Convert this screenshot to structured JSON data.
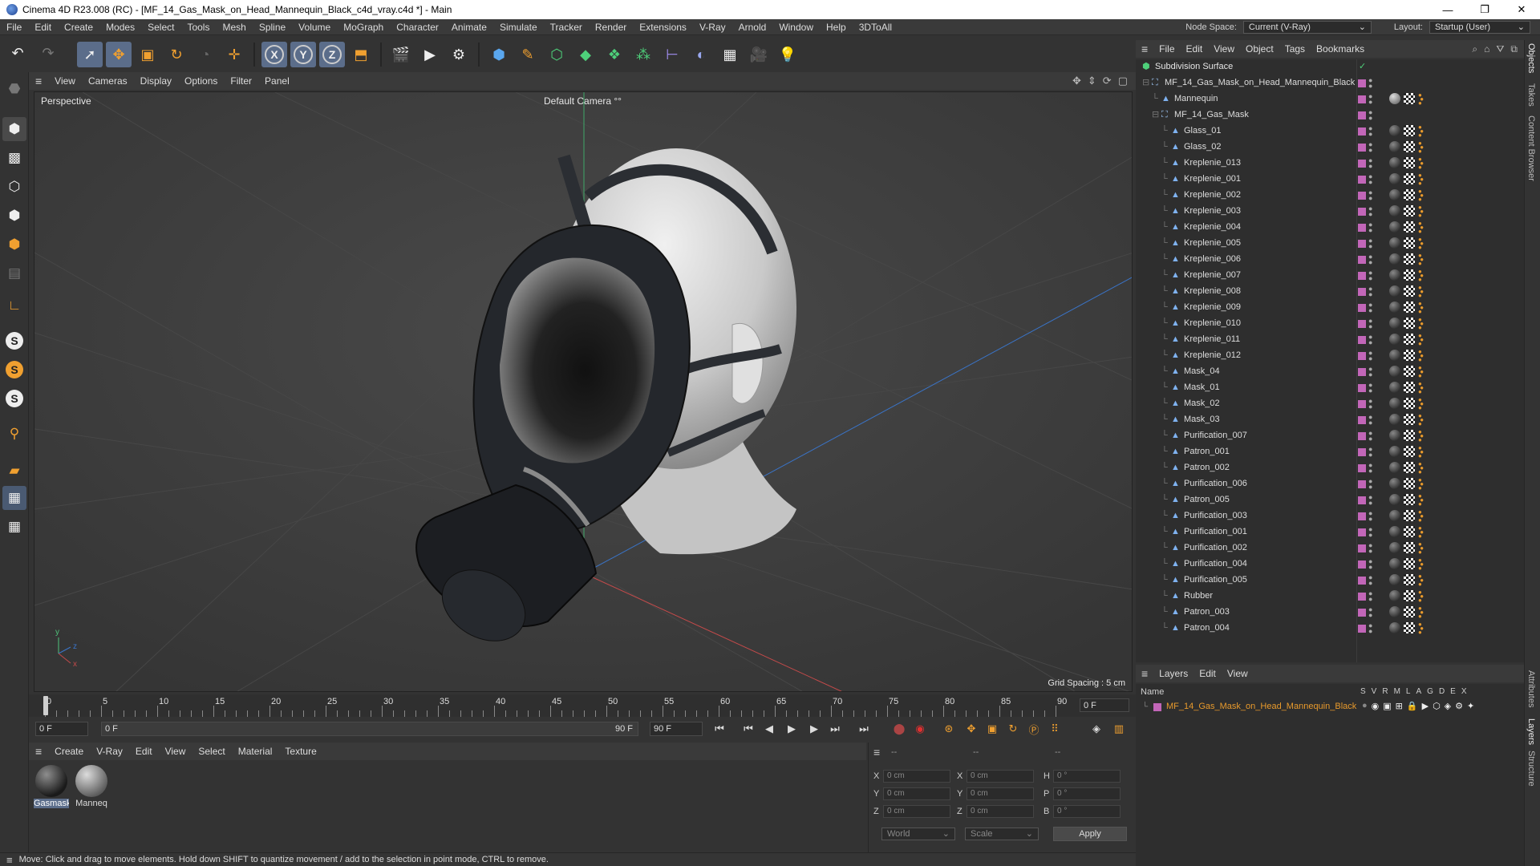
{
  "title": "Cinema 4D R23.008 (RC) - [MF_14_Gas_Mask_on_Head_Mannequin_Black_c4d_vray.c4d *] - Main",
  "window_controls": {
    "minimize": "—",
    "maximize": "❐",
    "close": "✕"
  },
  "menubar": {
    "items": [
      "File",
      "Edit",
      "Create",
      "Modes",
      "Select",
      "Tools",
      "Mesh",
      "Spline",
      "Volume",
      "MoGraph",
      "Character",
      "Animate",
      "Simulate",
      "Tracker",
      "Render",
      "Extensions",
      "V-Ray",
      "Arnold",
      "Window",
      "Help",
      "3DToAll"
    ],
    "node_space_label": "Node Space:",
    "node_space_value": "Current (V-Ray)",
    "layout_label": "Layout:",
    "layout_value": "Startup (User)"
  },
  "toolbar": {
    "axis_x": "X",
    "axis_y": "Y",
    "axis_z": "Z"
  },
  "viewport": {
    "menu": [
      "View",
      "Cameras",
      "Display",
      "Options",
      "Filter",
      "Panel"
    ],
    "label": "Perspective",
    "camera": "Default Camera °°",
    "grid_spacing": "Grid Spacing : 5 cm"
  },
  "timeline": {
    "ticks": [
      "0",
      "5",
      "10",
      "15",
      "20",
      "25",
      "30",
      "35",
      "40",
      "45",
      "50",
      "55",
      "60",
      "65",
      "70",
      "75",
      "80",
      "85",
      "90"
    ],
    "current_frame": "0 F",
    "start_field": "0 F",
    "range_start": "0 F",
    "range_end": "90 F",
    "end_field": "90 F"
  },
  "material_manager": {
    "menu": [
      "Create",
      "V-Ray",
      "Edit",
      "View",
      "Select",
      "Material",
      "Texture"
    ],
    "materials": [
      {
        "name": "Gasmask",
        "selected": true
      },
      {
        "name": "Manneq",
        "selected": false
      }
    ]
  },
  "coordinates": {
    "header": [
      "--",
      "--",
      "--"
    ],
    "rows": [
      {
        "a": "X",
        "av": "0 cm",
        "b": "X",
        "bv": "0 cm",
        "c": "H",
        "cv": "0 °"
      },
      {
        "a": "Y",
        "av": "0 cm",
        "b": "Y",
        "bv": "0 cm",
        "c": "P",
        "cv": "0 °"
      },
      {
        "a": "Z",
        "av": "0 cm",
        "b": "Z",
        "bv": "0 cm",
        "c": "B",
        "cv": "0 °"
      }
    ],
    "mode": "World",
    "scale": "Scale",
    "apply": "Apply"
  },
  "status": "Move: Click and drag to move elements. Hold down SHIFT to quantize movement / add to the selection in point mode, CTRL to remove.",
  "object_manager": {
    "menu": [
      "File",
      "Edit",
      "View",
      "Object",
      "Tags",
      "Bookmarks"
    ],
    "objects": [
      {
        "name": "Subdivision Surface",
        "level": 0,
        "kind": "subdiv"
      },
      {
        "name": "MF_14_Gas_Mask_on_Head_Mannequin_Black",
        "level": 1,
        "kind": "null"
      },
      {
        "name": "Mannequin",
        "level": 2,
        "kind": "mesh"
      },
      {
        "name": "MF_14_Gas_Mask",
        "level": 2,
        "kind": "null"
      },
      {
        "name": "Glass_01",
        "level": 3,
        "kind": "mesh"
      },
      {
        "name": "Glass_02",
        "level": 3,
        "kind": "mesh"
      },
      {
        "name": "Kreplenie_013",
        "level": 3,
        "kind": "mesh"
      },
      {
        "name": "Kreplenie_001",
        "level": 3,
        "kind": "mesh"
      },
      {
        "name": "Kreplenie_002",
        "level": 3,
        "kind": "mesh"
      },
      {
        "name": "Kreplenie_003",
        "level": 3,
        "kind": "mesh"
      },
      {
        "name": "Kreplenie_004",
        "level": 3,
        "kind": "mesh"
      },
      {
        "name": "Kreplenie_005",
        "level": 3,
        "kind": "mesh"
      },
      {
        "name": "Kreplenie_006",
        "level": 3,
        "kind": "mesh"
      },
      {
        "name": "Kreplenie_007",
        "level": 3,
        "kind": "mesh"
      },
      {
        "name": "Kreplenie_008",
        "level": 3,
        "kind": "mesh"
      },
      {
        "name": "Kreplenie_009",
        "level": 3,
        "kind": "mesh"
      },
      {
        "name": "Kreplenie_010",
        "level": 3,
        "kind": "mesh"
      },
      {
        "name": "Kreplenie_011",
        "level": 3,
        "kind": "mesh"
      },
      {
        "name": "Kreplenie_012",
        "level": 3,
        "kind": "mesh"
      },
      {
        "name": "Mask_04",
        "level": 3,
        "kind": "mesh"
      },
      {
        "name": "Mask_01",
        "level": 3,
        "kind": "mesh"
      },
      {
        "name": "Mask_02",
        "level": 3,
        "kind": "mesh"
      },
      {
        "name": "Mask_03",
        "level": 3,
        "kind": "mesh"
      },
      {
        "name": "Purification_007",
        "level": 3,
        "kind": "mesh"
      },
      {
        "name": "Patron_001",
        "level": 3,
        "kind": "mesh"
      },
      {
        "name": "Patron_002",
        "level": 3,
        "kind": "mesh"
      },
      {
        "name": "Purification_006",
        "level": 3,
        "kind": "mesh"
      },
      {
        "name": "Patron_005",
        "level": 3,
        "kind": "mesh"
      },
      {
        "name": "Purification_003",
        "level": 3,
        "kind": "mesh"
      },
      {
        "name": "Purification_001",
        "level": 3,
        "kind": "mesh"
      },
      {
        "name": "Purification_002",
        "level": 3,
        "kind": "mesh"
      },
      {
        "name": "Purification_004",
        "level": 3,
        "kind": "mesh"
      },
      {
        "name": "Purification_005",
        "level": 3,
        "kind": "mesh"
      },
      {
        "name": "Rubber",
        "level": 3,
        "kind": "mesh"
      },
      {
        "name": "Patron_003",
        "level": 3,
        "kind": "mesh"
      },
      {
        "name": "Patron_004",
        "level": 3,
        "kind": "mesh"
      }
    ]
  },
  "layers": {
    "menu": [
      "Layers",
      "Edit",
      "View"
    ],
    "header_name": "Name",
    "header_flags": [
      "S",
      "V",
      "R",
      "M",
      "L",
      "A",
      "G",
      "D",
      "E",
      "X"
    ],
    "items": [
      {
        "name": "MF_14_Gas_Mask_on_Head_Mannequin_Black",
        "color": "#c266b8"
      }
    ]
  },
  "right_tabs": [
    "Objects",
    "Takes",
    "Content Browser",
    "Attributes",
    "Layers",
    "Structure"
  ],
  "colors": {
    "accent_orange": "#e89a2c",
    "layer_pink": "#c266b8",
    "selection_blue": "#5b6d8a"
  }
}
